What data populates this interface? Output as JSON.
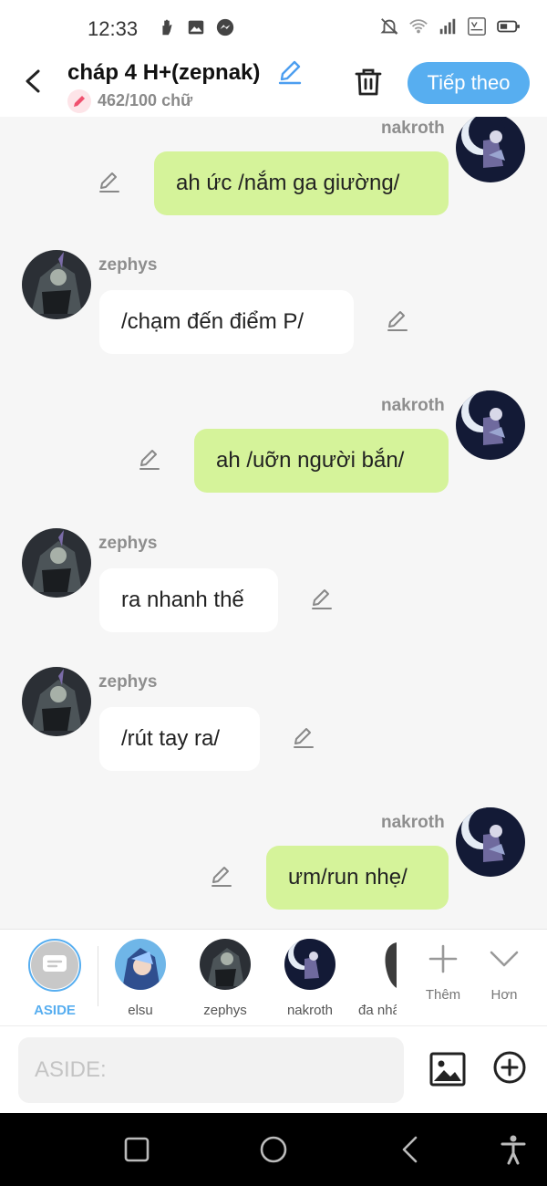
{
  "status": {
    "time": "12:33",
    "left_icons": [
      "hand-icon",
      "image-icon",
      "messenger-icon"
    ],
    "right_icons": [
      "mute-icon",
      "wifi-icon",
      "signal-icon",
      "volte-icon",
      "battery-icon"
    ]
  },
  "header": {
    "title": "cháp 4 H+(zepnak)",
    "word_count": "462/100 chữ",
    "next_label": "Tiếp theo"
  },
  "messages": [
    {
      "side": "right",
      "sender": "nakroth",
      "text": "ah ức /nắm ga giường/"
    },
    {
      "side": "left",
      "sender": "zephys",
      "text": "/chạm đến điểm P/"
    },
    {
      "side": "right",
      "sender": "nakroth",
      "text": "ah /uỡn người bắn/"
    },
    {
      "side": "left",
      "sender": "zephys",
      "text": "ra nhanh thế"
    },
    {
      "side": "left",
      "sender": "zephys",
      "text": "/rút tay ra/"
    },
    {
      "side": "right",
      "sender": "nakroth",
      "text": "ưm/run nhẹ/"
    }
  ],
  "characters": {
    "aside": "ASIDE",
    "items": [
      "elsu",
      "zephys",
      "nakroth",
      "đa nhân cách"
    ],
    "more_label": "Thêm",
    "collapse_label": "Hơn"
  },
  "input": {
    "placeholder": "ASIDE:"
  },
  "colors": {
    "accent": "#57aef0",
    "bubble_right": "#d5f39a",
    "bubble_left": "#ffffff",
    "background": "#f6f6f6"
  }
}
